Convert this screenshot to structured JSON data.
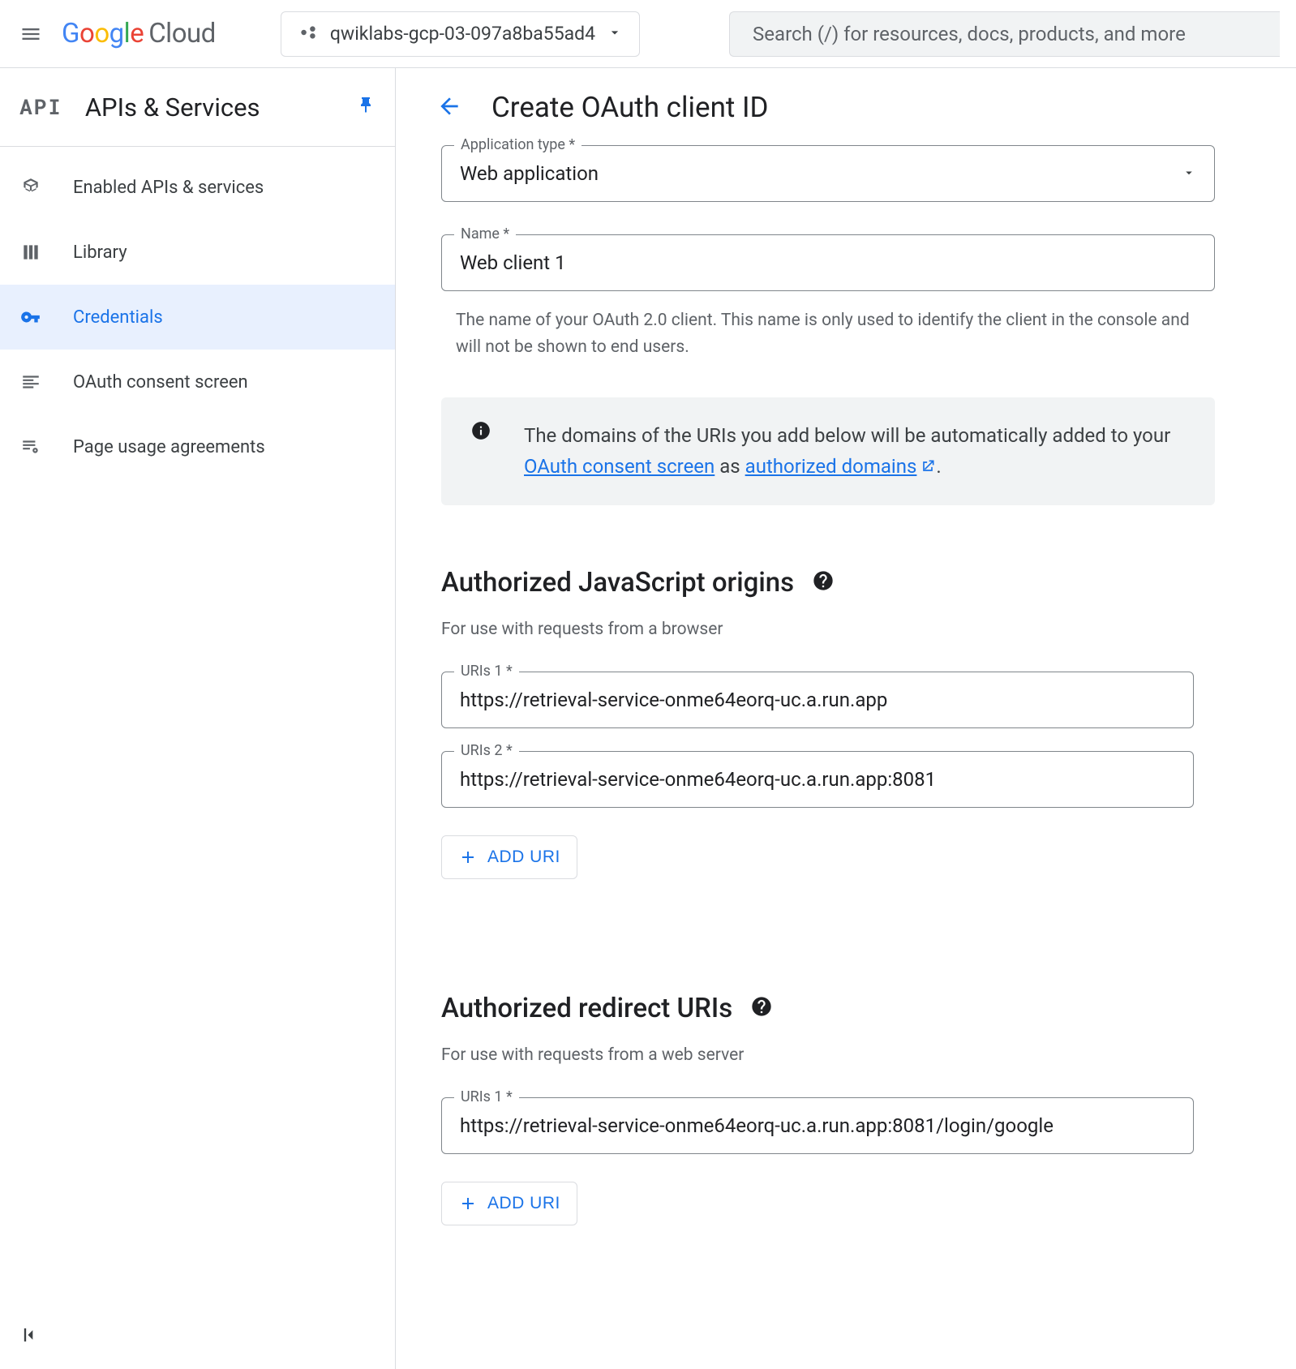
{
  "header": {
    "project_name": "qwiklabs-gcp-03-097a8ba55ad4",
    "search_placeholder": "Search (/) for resources, docs, products, and more"
  },
  "sidebar": {
    "title": "APIs & Services",
    "badge": "API",
    "items": [
      {
        "label": "Enabled APIs & services"
      },
      {
        "label": "Library"
      },
      {
        "label": "Credentials"
      },
      {
        "label": "OAuth consent screen"
      },
      {
        "label": "Page usage agreements"
      }
    ]
  },
  "page": {
    "title": "Create OAuth client ID",
    "app_type_label": "Application type *",
    "app_type_value": "Web application",
    "name_label": "Name *",
    "name_value": "Web client 1",
    "name_helper": "The name of your OAuth 2.0 client. This name is only used to identify the client in the console and will not be shown to end users.",
    "info_pre": "The domains of the URIs you add below will be automatically added to your ",
    "info_link1": "OAuth consent screen",
    "info_mid": " as ",
    "info_link2": "authorized domains",
    "js_origins_heading": "Authorized JavaScript origins",
    "js_origins_sub": "For use with requests from a browser",
    "js_uris": [
      {
        "label": "URIs 1 *",
        "value": "https://retrieval-service-onme64eorq-uc.a.run.app"
      },
      {
        "label": "URIs 2 *",
        "value": "https://retrieval-service-onme64eorq-uc.a.run.app:8081"
      }
    ],
    "redirect_heading": "Authorized redirect URIs",
    "redirect_sub": "For use with requests from a web server",
    "redirect_uris": [
      {
        "label": "URIs 1 *",
        "value": "https://retrieval-service-onme64eorq-uc.a.run.app:8081/login/google"
      }
    ],
    "add_uri_label": "ADD URI"
  }
}
